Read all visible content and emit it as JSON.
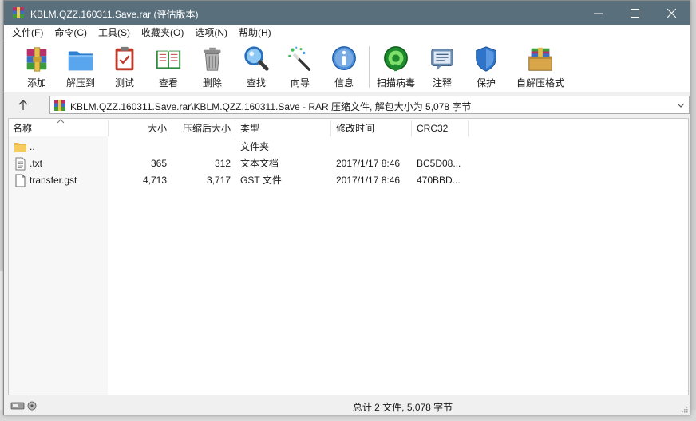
{
  "window": {
    "title": "KBLM.QZZ.160311.Save.rar (评估版本)",
    "colors": {
      "titlebar": "#5a6f7c",
      "accent": "#2b78c5"
    }
  },
  "menu": [
    {
      "label": "文件(F)"
    },
    {
      "label": "命令(C)"
    },
    {
      "label": "工具(S)"
    },
    {
      "label": "收藏夹(O)"
    },
    {
      "label": "选项(N)"
    },
    {
      "label": "帮助(H)"
    }
  ],
  "toolbar": [
    {
      "label": "添加",
      "icon": "add-archive-icon"
    },
    {
      "label": "解压到",
      "icon": "extract-folder-icon"
    },
    {
      "label": "测试",
      "icon": "test-clipboard-icon"
    },
    {
      "label": "查看",
      "icon": "view-book-icon"
    },
    {
      "label": "删除",
      "icon": "trash-icon"
    },
    {
      "label": "查找",
      "icon": "magnifier-icon"
    },
    {
      "label": "向导",
      "icon": "wizard-wand-icon"
    },
    {
      "label": "信息",
      "icon": "info-icon"
    },
    {
      "label": "扫描病毒",
      "icon": "virus-scan-icon"
    },
    {
      "label": "注释",
      "icon": "comment-icon"
    },
    {
      "label": "保护",
      "icon": "shield-icon"
    },
    {
      "label": "自解压格式",
      "icon": "sfx-package-icon"
    }
  ],
  "address": {
    "path": "KBLM.QZZ.160311.Save.rar\\KBLM.QZZ.160311.Save - RAR 压缩文件, 解包大小为 5,078 字节"
  },
  "columns": {
    "name": "名称",
    "size": "大小",
    "packed": "压缩后大小",
    "type": "类型",
    "modified": "修改时间",
    "crc": "CRC32"
  },
  "files": [
    {
      "name": "..",
      "size": "",
      "packed": "",
      "type": "文件夹",
      "modified": "",
      "crc": "",
      "icon": "folder-icon"
    },
    {
      "name": ".txt",
      "size": "365",
      "packed": "312",
      "type": "文本文档",
      "modified": "2017/1/17 8:46",
      "crc": "BC5D08...",
      "icon": "text-file-icon"
    },
    {
      "name": "transfer.gst",
      "size": "4,713",
      "packed": "3,717",
      "type": "GST 文件",
      "modified": "2017/1/17 8:46",
      "crc": "470BBD...",
      "icon": "file-icon"
    }
  ],
  "status": {
    "summary": "总计 2 文件, 5,078 字节"
  }
}
